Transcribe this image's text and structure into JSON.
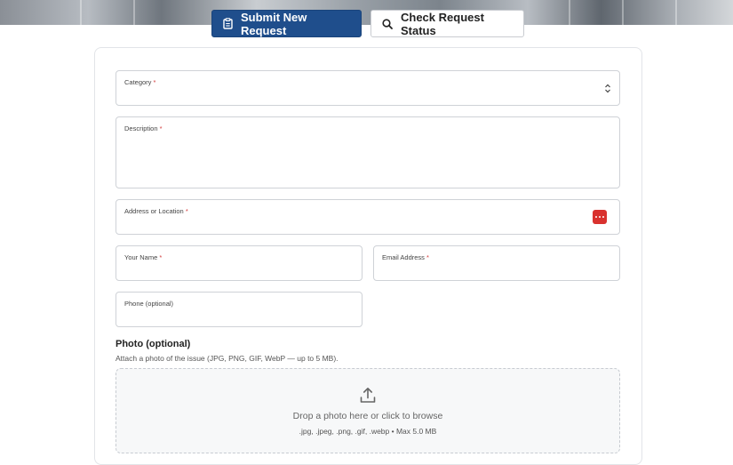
{
  "tabs": {
    "submit_label": "Submit New Request",
    "status_label": "Check Request Status"
  },
  "form": {
    "category_label": "Category",
    "description_label": "Description",
    "address_label": "Address or Location",
    "name_label": "Your Name",
    "email_label": "Email Address",
    "phone_label": "Phone (optional)",
    "required_marker": "*"
  },
  "photo": {
    "title": "Photo (optional)",
    "help": "Attach a photo of the issue (JPG, PNG, GIF, WebP — up to 5 MB).",
    "drop_text": "Drop a photo here or click to browse",
    "formats_text": ".jpg, .jpeg, .png, .gif, .webp • Max 5.0 MB"
  },
  "colors": {
    "primary": "#1f4e8c",
    "required": "#d23a3a",
    "address_button": "#d9322f"
  },
  "icons": {
    "submit_tab": "clipboard-icon",
    "status_tab": "search-icon",
    "category_select": "chevron-updown-icon",
    "address_button": "more-dots-icon",
    "dropzone": "upload-icon"
  }
}
